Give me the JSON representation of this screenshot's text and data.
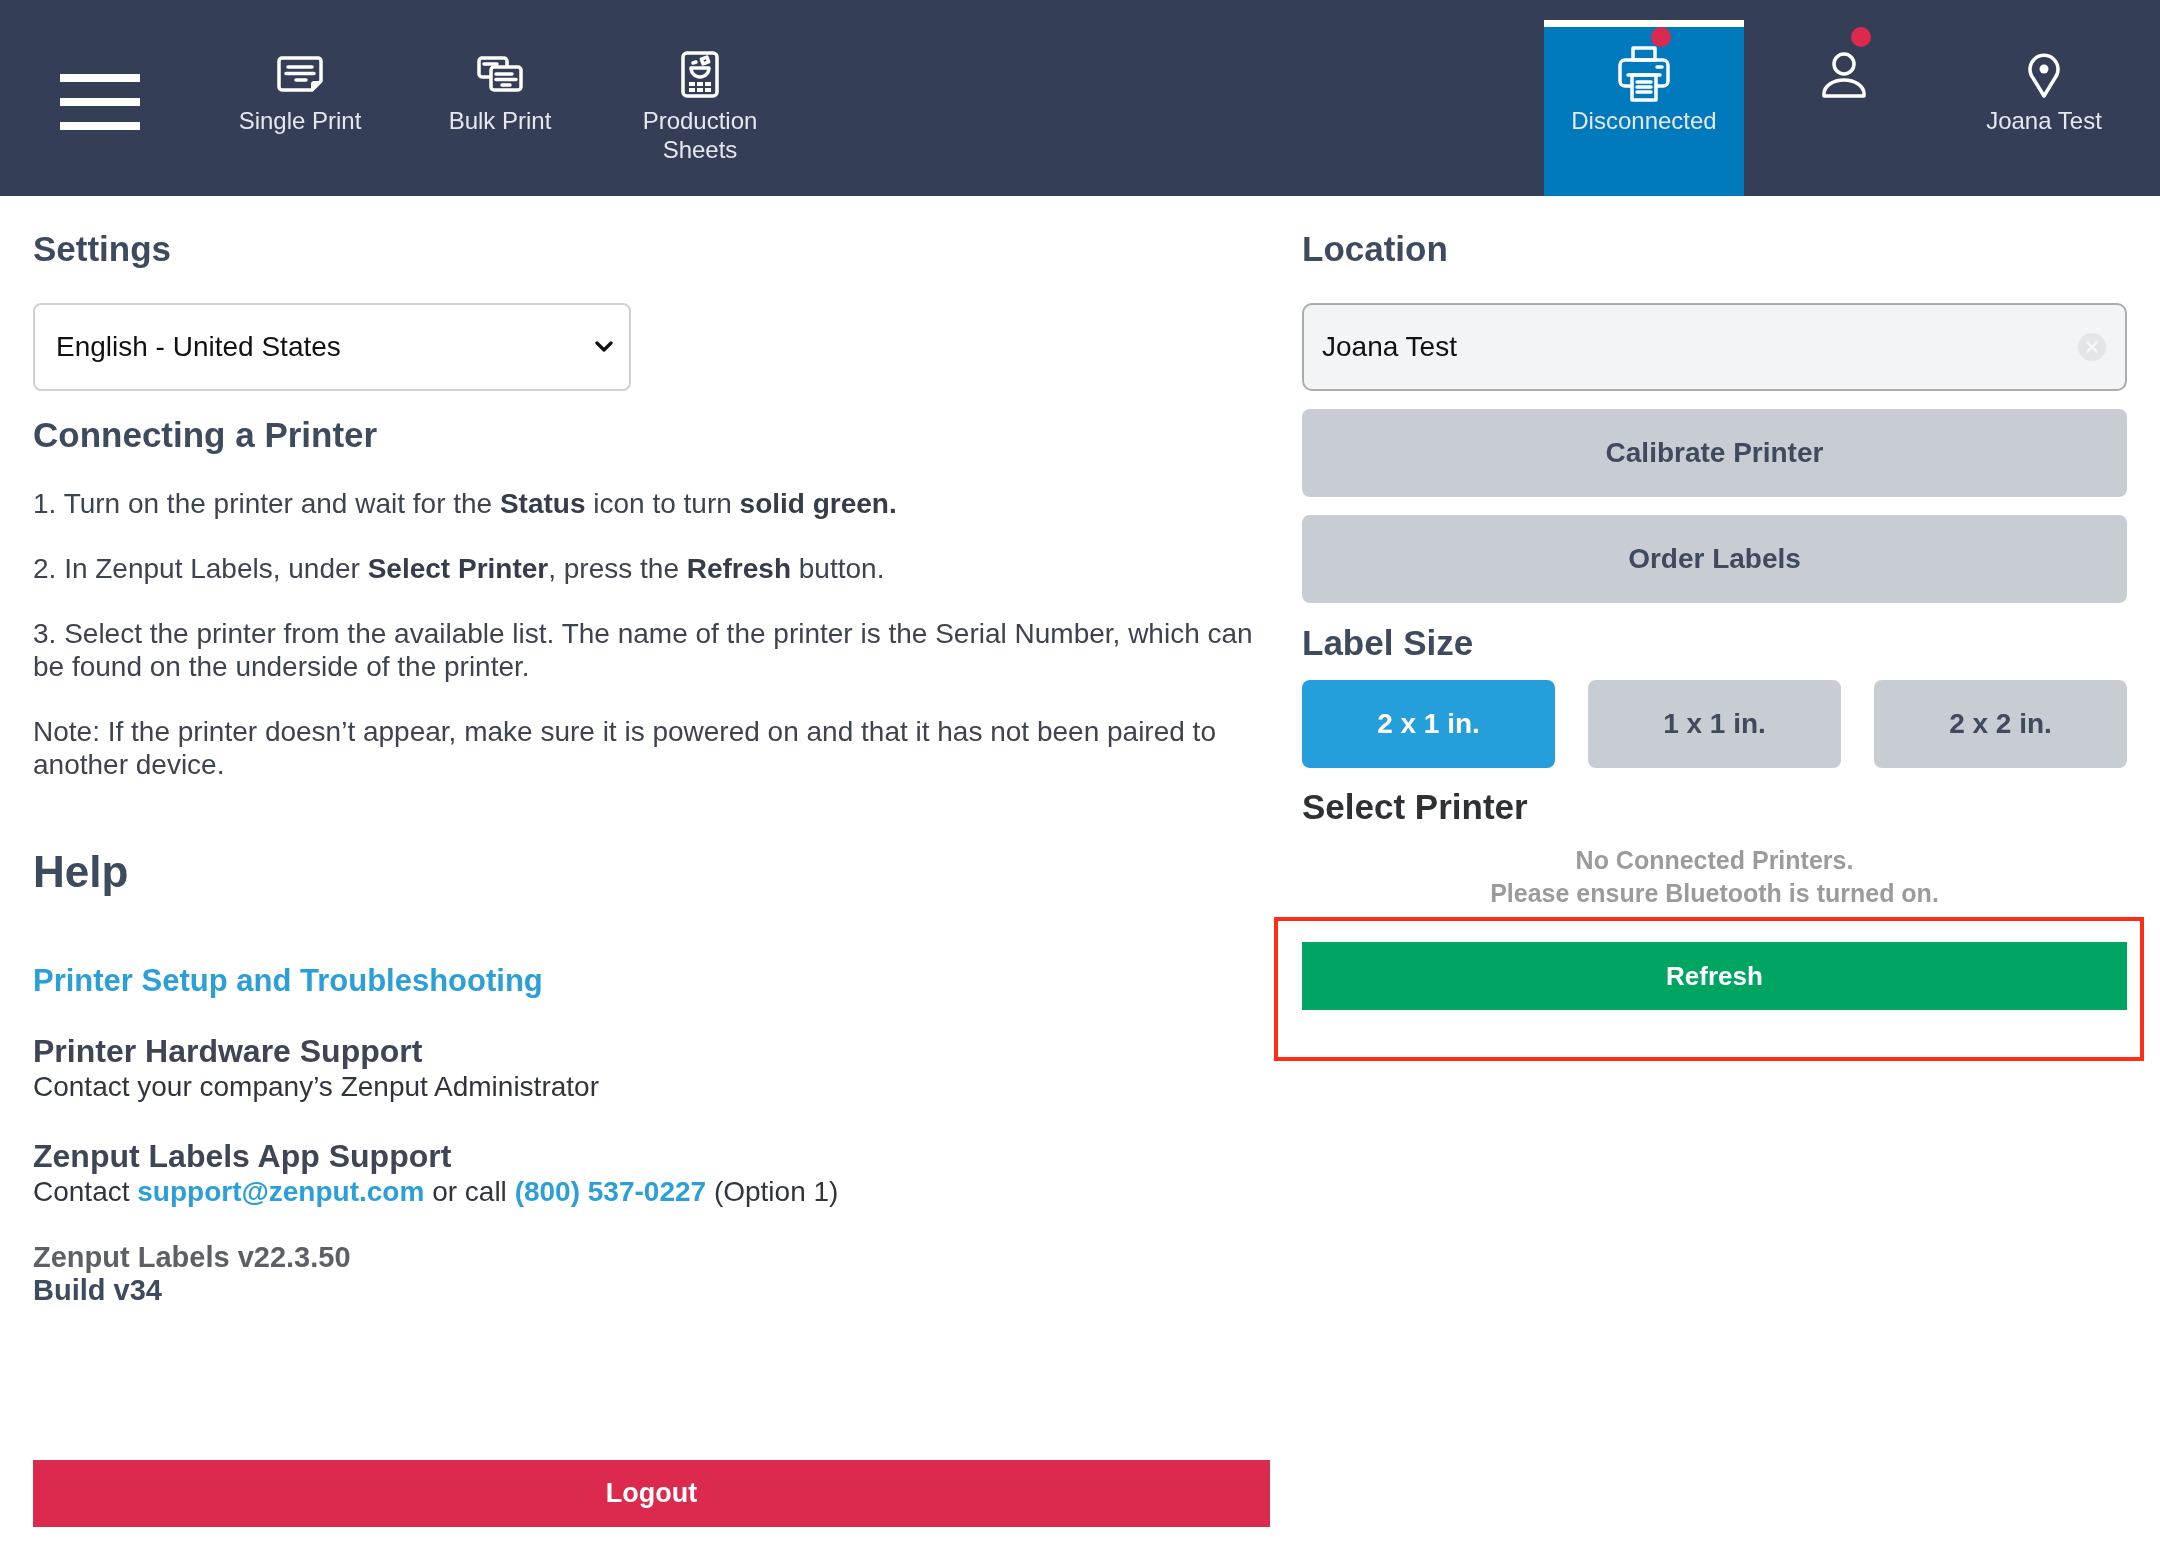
{
  "nav": {
    "left_tabs": [
      {
        "kind": "single",
        "label": "Single Print",
        "selected": false
      },
      {
        "kind": "bulk",
        "label": "Bulk Print",
        "selected": false
      },
      {
        "kind": "production",
        "label": "Production Sheets",
        "selected": false
      }
    ],
    "right_tabs": [
      {
        "kind": "printer",
        "label": "Disconnected",
        "selected": true,
        "alert": true
      },
      {
        "kind": "user",
        "selected": false,
        "alert": true
      },
      {
        "kind": "location",
        "label": "Joana Test",
        "selected": false,
        "alert": false
      }
    ]
  },
  "settings": {
    "title": "Settings",
    "language": {
      "value": "English - United States"
    }
  },
  "connecting": {
    "title": "Connecting a Printer",
    "steps": [
      "1. Turn on the printer and wait for the **Status** icon to turn **solid green.**",
      "2. In Zenput Labels, under **Select Printer**, press the **Refresh** button.",
      "3. Select the printer from the available list. The name of the printer is the Serial Number, which can be found on the underside of the printer.",
      "Note: If the printer doesn’t appear, make sure it is powered on and that it has not been paired to another device."
    ]
  },
  "help": {
    "title": "Help",
    "link": "Printer Setup and Troubleshooting",
    "sections": [
      {
        "title": "Printer Hardware Support",
        "parts": [
          {
            "kind": "text",
            "text": "Contact your company’s Zenput Administrator"
          }
        ]
      },
      {
        "title": "Zenput Labels App Support",
        "parts": [
          {
            "kind": "text",
            "text": "Contact"
          },
          {
            "kind": "link",
            "text": "support@zenput.com"
          },
          {
            "kind": "text",
            "text": "or call"
          },
          {
            "kind": "link",
            "text": "(800) 537-0227"
          },
          {
            "kind": "text",
            "text": "(Option 1)"
          }
        ]
      }
    ],
    "version": "Zenput Labels v22.3.50",
    "build": "Build v34"
  },
  "logout": {
    "label": "Logout"
  },
  "location": {
    "title": "Location",
    "value": "Joana Test"
  },
  "actions": [
    {
      "label": "Calibrate Printer"
    },
    {
      "label": "Order Labels"
    }
  ],
  "label_size": {
    "title": "Label Size",
    "options": [
      {
        "label": "2 x 1 in.",
        "selected": true
      },
      {
        "label": "1 x 1 in.",
        "selected": false
      },
      {
        "label": "2 x 2 in.",
        "selected": false
      }
    ]
  },
  "select_printer": {
    "title": "Select Printer",
    "message_lines": [
      "No Connected Printers.",
      "Please ensure Bluetooth is turned on."
    ],
    "refresh": {
      "label": "Refresh",
      "highlighted": true
    }
  }
}
